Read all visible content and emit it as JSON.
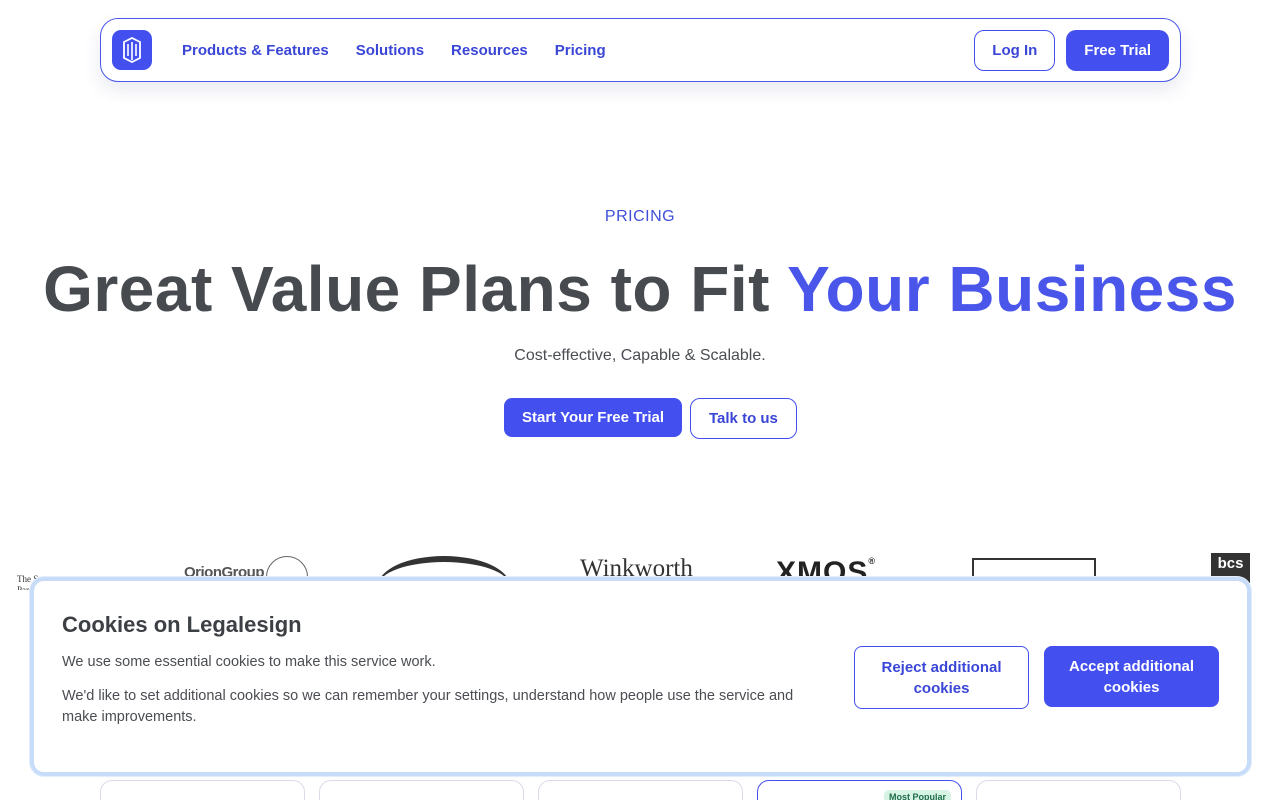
{
  "nav": {
    "links": [
      "Products & Features",
      "Solutions",
      "Resources",
      "Pricing"
    ],
    "login_label": "Log In",
    "trial_label": "Free Trial"
  },
  "hero": {
    "eyebrow": "PRICING",
    "headline_main": "Great Value Plans to Fit ",
    "headline_accent": "Your Business",
    "subhead": "Cost-effective, Capable & Scalable.",
    "cta_primary": "Start Your Free Trial",
    "cta_secondary": "Talk to us"
  },
  "client_logos": {
    "logo_1": "The S\nPar",
    "logo_2": "OrionGroup",
    "logo_4": "Winkworth",
    "logo_5": "XMOS",
    "logo_7": "bcs"
  },
  "pricing_cards": {
    "popular_badge": "Most Popular"
  },
  "cookie_banner": {
    "title": "Cookies on Legalesign",
    "text_1": "We use some essential cookies to make this service work.",
    "text_2": "We'd like to set additional cookies so we can remember your settings, understand how people use the service and make improvements.",
    "reject_label": "Reject additional cookies",
    "accept_label": "Accept additional cookies"
  },
  "colors": {
    "brand": "#4350ef",
    "accent_text": "#4a56ea",
    "banner_border": "#c7dcf8"
  }
}
